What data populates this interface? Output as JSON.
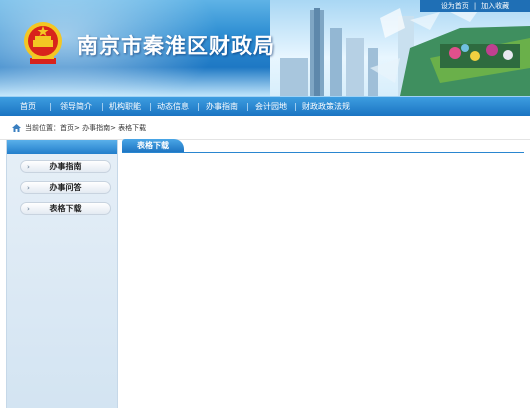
{
  "header": {
    "top_links": [
      "设为首页",
      "加入收藏"
    ],
    "site_title": "南京市秦淮区财政局"
  },
  "nav": {
    "items": [
      "首页",
      "领导简介",
      "机构职能",
      "动态信息",
      "办事指南",
      "会计园地",
      "财政政策法规"
    ]
  },
  "breadcrumb": {
    "text": "当前位置：首页> 办事指南> 表格下载"
  },
  "sidebar": {
    "items": [
      "办事指南",
      "办事问答",
      "表格下载"
    ]
  },
  "content": {
    "tab_label": "表格下载"
  },
  "colors": {
    "nav_blue": "#1b74c2",
    "banner_blue": "#2f8fd3",
    "emblem_red": "#d8231c",
    "emblem_gold": "#f3c623"
  }
}
